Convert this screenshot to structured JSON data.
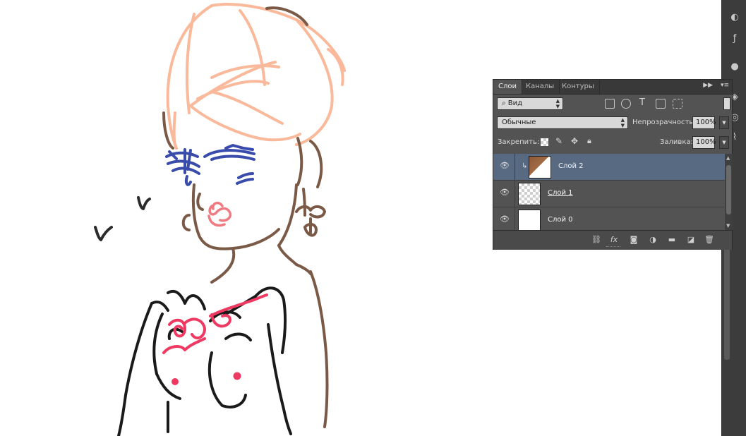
{
  "panel": {
    "tabs": [
      "Слои",
      "Каналы",
      "Контуры"
    ],
    "filter": {
      "label": "Вид"
    },
    "filter_icons": [
      "image-filter-icon",
      "adjustment-filter-icon",
      "text-filter-icon",
      "shape-filter-icon",
      "smart-object-filter-icon"
    ],
    "blend_mode": "Обычные",
    "opacity_label": "Непрозрачность:",
    "opacity_value": "100%",
    "lock_label": "Закрепить:",
    "lock_icons": [
      "lock-transparent-icon",
      "lock-paint-icon",
      "lock-move-icon",
      "lock-all-icon"
    ],
    "fill_label": "Заливка:",
    "fill_value": "100%",
    "layers": [
      {
        "name": "Слой 2",
        "selected": true,
        "visible": true,
        "clipped": true,
        "thumb": "brown-photo"
      },
      {
        "name": "Слой 1",
        "selected": false,
        "visible": true,
        "clipped": false,
        "thumb": "sketch-transparent"
      },
      {
        "name": "Слой 0",
        "selected": false,
        "visible": true,
        "clipped": false,
        "thumb": "white"
      }
    ],
    "footer_icons": [
      "link-layers-icon",
      "fx-icon",
      "mask-icon",
      "adjustment-layer-icon",
      "group-folder-icon",
      "new-layer-icon",
      "trash-icon"
    ],
    "footer_fx": "fx"
  },
  "colors": {
    "panel_bg": "#535353",
    "selected_row": "#576a82",
    "toolbar_bg": "#3c3c3c",
    "hair": "#f9b99a",
    "eyes": "#3a4cab",
    "lips": "#f07a82",
    "skin_lines": "#7a5a46",
    "body_lines": "#1a1a1a",
    "accent_pink": "#ee3a62"
  }
}
